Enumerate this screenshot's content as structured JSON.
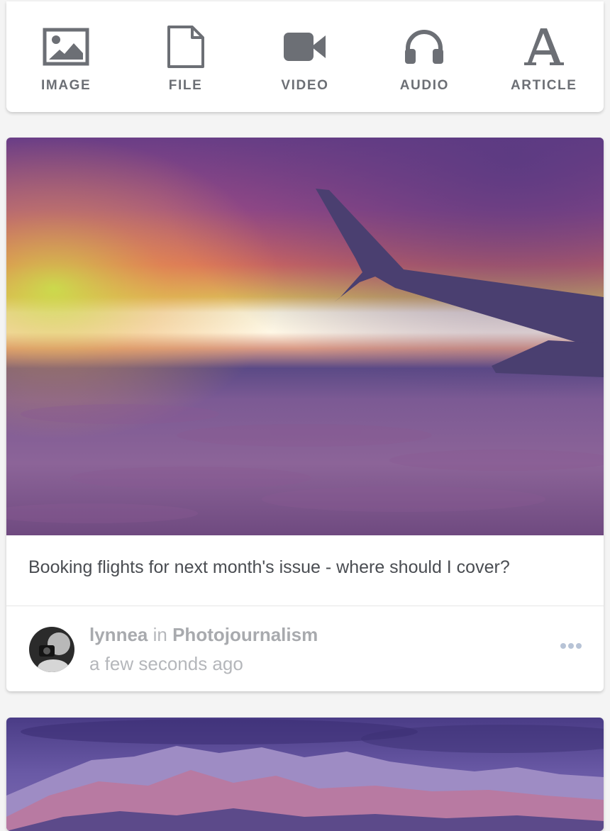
{
  "composer": {
    "buttons": [
      {
        "label": "IMAGE",
        "icon": "image-icon"
      },
      {
        "label": "FILE",
        "icon": "file-icon"
      },
      {
        "label": "VIDEO",
        "icon": "video-camera-icon"
      },
      {
        "label": "AUDIO",
        "icon": "headphones-icon"
      },
      {
        "label": "ARTICLE",
        "icon": "article-letter-a-icon"
      }
    ],
    "icon_color": "#6c6f75"
  },
  "posts": [
    {
      "image": "airplane-wing-sunset-photo",
      "caption": "Booking flights for next month's issue - where should I cover?",
      "author": "lynnea",
      "in_word": "in",
      "group": "Photojournalism",
      "time": "a few seconds ago",
      "more_icon": "ellipsis-icon"
    },
    {
      "image": "purple-mountains-photo"
    }
  ]
}
